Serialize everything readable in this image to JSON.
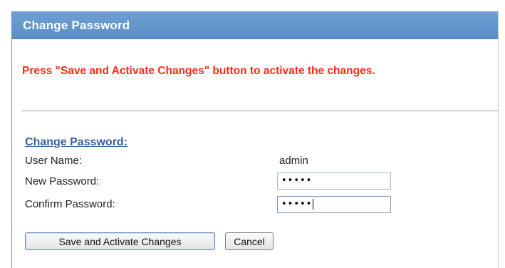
{
  "header": {
    "title": "Change Password"
  },
  "notice": {
    "text": "Press \"Save and Activate Changes\" button to activate the changes."
  },
  "section": {
    "title": "Change Password:"
  },
  "form": {
    "username_label": "User Name:",
    "username_value": "admin",
    "new_password_label": "New Password:",
    "new_password_value": "•••••",
    "confirm_password_label": "Confirm Password:",
    "confirm_password_value": "•••••"
  },
  "buttons": {
    "save_label": "Save and Activate Changes",
    "cancel_label": "Cancel"
  },
  "colors": {
    "header_bg": "#5b8fc8",
    "notice_text": "#ff2a17",
    "section_title": "#3b5fa0"
  }
}
